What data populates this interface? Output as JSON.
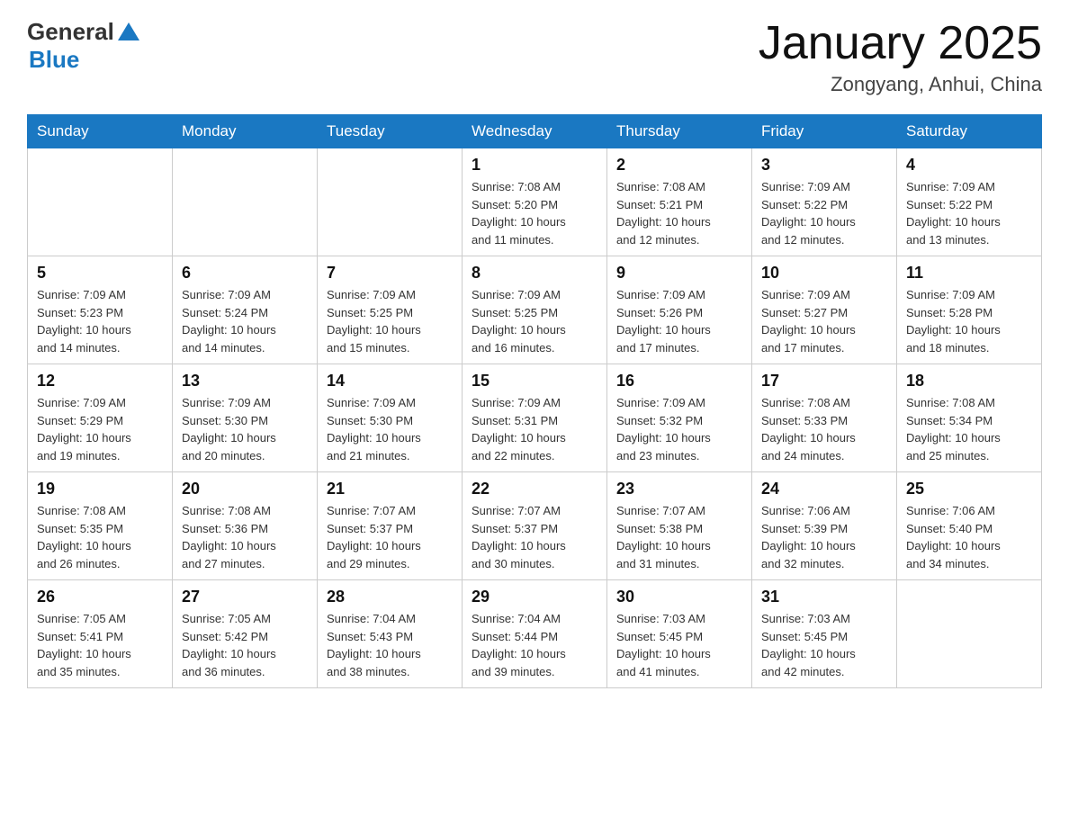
{
  "header": {
    "logo_general": "General",
    "logo_blue": "Blue",
    "title": "January 2025",
    "subtitle": "Zongyang, Anhui, China"
  },
  "days_of_week": [
    "Sunday",
    "Monday",
    "Tuesday",
    "Wednesday",
    "Thursday",
    "Friday",
    "Saturday"
  ],
  "weeks": [
    {
      "days": [
        {
          "num": "",
          "info": ""
        },
        {
          "num": "",
          "info": ""
        },
        {
          "num": "",
          "info": ""
        },
        {
          "num": "1",
          "info": "Sunrise: 7:08 AM\nSunset: 5:20 PM\nDaylight: 10 hours\nand 11 minutes."
        },
        {
          "num": "2",
          "info": "Sunrise: 7:08 AM\nSunset: 5:21 PM\nDaylight: 10 hours\nand 12 minutes."
        },
        {
          "num": "3",
          "info": "Sunrise: 7:09 AM\nSunset: 5:22 PM\nDaylight: 10 hours\nand 12 minutes."
        },
        {
          "num": "4",
          "info": "Sunrise: 7:09 AM\nSunset: 5:22 PM\nDaylight: 10 hours\nand 13 minutes."
        }
      ]
    },
    {
      "days": [
        {
          "num": "5",
          "info": "Sunrise: 7:09 AM\nSunset: 5:23 PM\nDaylight: 10 hours\nand 14 minutes."
        },
        {
          "num": "6",
          "info": "Sunrise: 7:09 AM\nSunset: 5:24 PM\nDaylight: 10 hours\nand 14 minutes."
        },
        {
          "num": "7",
          "info": "Sunrise: 7:09 AM\nSunset: 5:25 PM\nDaylight: 10 hours\nand 15 minutes."
        },
        {
          "num": "8",
          "info": "Sunrise: 7:09 AM\nSunset: 5:25 PM\nDaylight: 10 hours\nand 16 minutes."
        },
        {
          "num": "9",
          "info": "Sunrise: 7:09 AM\nSunset: 5:26 PM\nDaylight: 10 hours\nand 17 minutes."
        },
        {
          "num": "10",
          "info": "Sunrise: 7:09 AM\nSunset: 5:27 PM\nDaylight: 10 hours\nand 17 minutes."
        },
        {
          "num": "11",
          "info": "Sunrise: 7:09 AM\nSunset: 5:28 PM\nDaylight: 10 hours\nand 18 minutes."
        }
      ]
    },
    {
      "days": [
        {
          "num": "12",
          "info": "Sunrise: 7:09 AM\nSunset: 5:29 PM\nDaylight: 10 hours\nand 19 minutes."
        },
        {
          "num": "13",
          "info": "Sunrise: 7:09 AM\nSunset: 5:30 PM\nDaylight: 10 hours\nand 20 minutes."
        },
        {
          "num": "14",
          "info": "Sunrise: 7:09 AM\nSunset: 5:30 PM\nDaylight: 10 hours\nand 21 minutes."
        },
        {
          "num": "15",
          "info": "Sunrise: 7:09 AM\nSunset: 5:31 PM\nDaylight: 10 hours\nand 22 minutes."
        },
        {
          "num": "16",
          "info": "Sunrise: 7:09 AM\nSunset: 5:32 PM\nDaylight: 10 hours\nand 23 minutes."
        },
        {
          "num": "17",
          "info": "Sunrise: 7:08 AM\nSunset: 5:33 PM\nDaylight: 10 hours\nand 24 minutes."
        },
        {
          "num": "18",
          "info": "Sunrise: 7:08 AM\nSunset: 5:34 PM\nDaylight: 10 hours\nand 25 minutes."
        }
      ]
    },
    {
      "days": [
        {
          "num": "19",
          "info": "Sunrise: 7:08 AM\nSunset: 5:35 PM\nDaylight: 10 hours\nand 26 minutes."
        },
        {
          "num": "20",
          "info": "Sunrise: 7:08 AM\nSunset: 5:36 PM\nDaylight: 10 hours\nand 27 minutes."
        },
        {
          "num": "21",
          "info": "Sunrise: 7:07 AM\nSunset: 5:37 PM\nDaylight: 10 hours\nand 29 minutes."
        },
        {
          "num": "22",
          "info": "Sunrise: 7:07 AM\nSunset: 5:37 PM\nDaylight: 10 hours\nand 30 minutes."
        },
        {
          "num": "23",
          "info": "Sunrise: 7:07 AM\nSunset: 5:38 PM\nDaylight: 10 hours\nand 31 minutes."
        },
        {
          "num": "24",
          "info": "Sunrise: 7:06 AM\nSunset: 5:39 PM\nDaylight: 10 hours\nand 32 minutes."
        },
        {
          "num": "25",
          "info": "Sunrise: 7:06 AM\nSunset: 5:40 PM\nDaylight: 10 hours\nand 34 minutes."
        }
      ]
    },
    {
      "days": [
        {
          "num": "26",
          "info": "Sunrise: 7:05 AM\nSunset: 5:41 PM\nDaylight: 10 hours\nand 35 minutes."
        },
        {
          "num": "27",
          "info": "Sunrise: 7:05 AM\nSunset: 5:42 PM\nDaylight: 10 hours\nand 36 minutes."
        },
        {
          "num": "28",
          "info": "Sunrise: 7:04 AM\nSunset: 5:43 PM\nDaylight: 10 hours\nand 38 minutes."
        },
        {
          "num": "29",
          "info": "Sunrise: 7:04 AM\nSunset: 5:44 PM\nDaylight: 10 hours\nand 39 minutes."
        },
        {
          "num": "30",
          "info": "Sunrise: 7:03 AM\nSunset: 5:45 PM\nDaylight: 10 hours\nand 41 minutes."
        },
        {
          "num": "31",
          "info": "Sunrise: 7:03 AM\nSunset: 5:45 PM\nDaylight: 10 hours\nand 42 minutes."
        },
        {
          "num": "",
          "info": ""
        }
      ]
    }
  ]
}
